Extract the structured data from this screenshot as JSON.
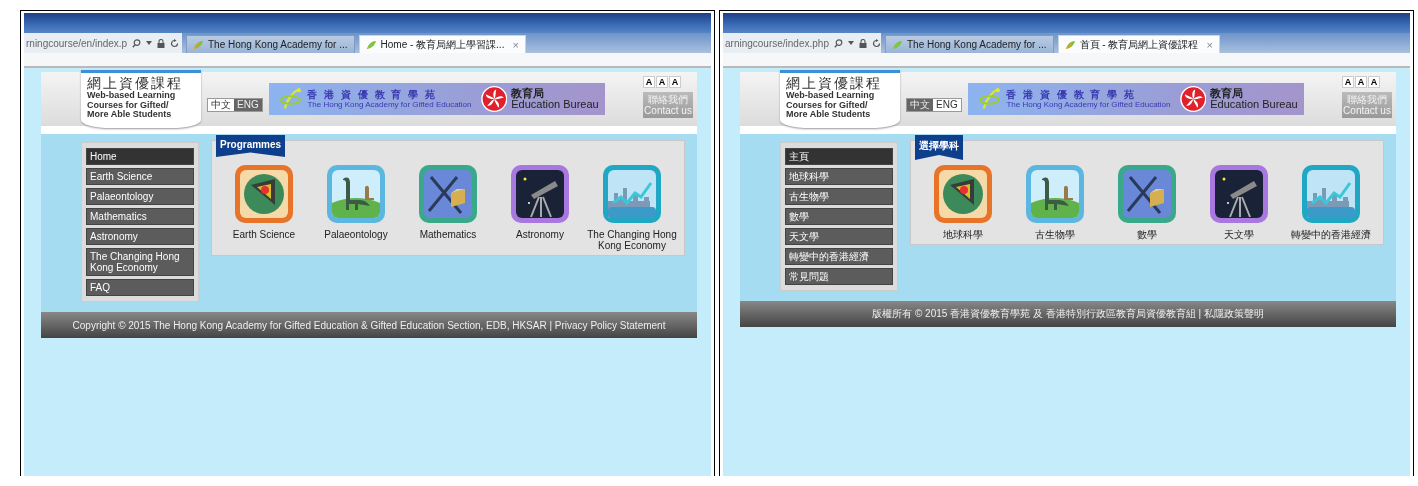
{
  "panels": [
    {
      "browser": {
        "address": "rningcourse/en/index.p",
        "tabs": [
          {
            "title": "The Hong Kong Academy for ...",
            "selected": false,
            "closable": false
          },
          {
            "title": "Home - 教育局網上學習課...",
            "selected": true,
            "closable": true,
            "close": "×"
          }
        ]
      },
      "site": {
        "logo_title": "網上資優課程",
        "logo_subtitle": "Web-based Learning Courses for Gifted/ More Able Students",
        "languages": [
          {
            "label": "中文",
            "selected": false
          },
          {
            "label": "ENG",
            "selected": true
          }
        ],
        "academy_cn": "香 港 資 優 教 育 學 苑",
        "academy_en": "The Hong Kong Academy for Gifted Education",
        "bureau_cn": "教育局",
        "bureau_en": "Education Bureau",
        "font_sizes": [
          "A",
          "A",
          "A"
        ],
        "contact_cn": "聯絡我們",
        "contact_en": "Contact us",
        "menu": [
          {
            "label": "Home",
            "selected": true
          },
          {
            "label": "Earth Science",
            "selected": false
          },
          {
            "label": "Palaeontology",
            "selected": false
          },
          {
            "label": "Mathematics",
            "selected": false
          },
          {
            "label": "Astronomy",
            "selected": false
          },
          {
            "label": "The Changing Hong Kong Economy",
            "selected": false
          },
          {
            "label": "FAQ",
            "selected": false
          }
        ],
        "programmes_heading": "Programmes",
        "programmes": [
          {
            "kind": "earth",
            "label": "Earth Science"
          },
          {
            "kind": "dinosaur",
            "label": "Palaeontology"
          },
          {
            "kind": "geometry",
            "label": "Mathematics"
          },
          {
            "kind": "telescope",
            "label": "Astronomy"
          },
          {
            "kind": "city",
            "label": "The Changing Hong Kong Economy"
          }
        ],
        "footer": "Copyright © 2015 The Hong Kong Academy for Gifted Education & Gifted Education Section, EDB, HKSAR | Privacy Policy Statement"
      }
    },
    {
      "browser": {
        "address": "arningcourse/index.php",
        "tabs": [
          {
            "title": "The Hong Kong Academy for ...",
            "selected": false,
            "closable": false
          },
          {
            "title": "首頁 - 教育局網上資優課程",
            "selected": true,
            "closable": true,
            "close": "×"
          }
        ]
      },
      "site": {
        "logo_title": "網上資優課程",
        "logo_subtitle": "Web-based Learning Courses for Gifted/ More Able Students",
        "languages": [
          {
            "label": "中文",
            "selected": true
          },
          {
            "label": "ENG",
            "selected": false
          }
        ],
        "academy_cn": "香 港 資 優 教 育 學 苑",
        "academy_en": "The Hong Kong Academy for Gifted Education",
        "bureau_cn": "教育局",
        "bureau_en": "Education Bureau",
        "font_sizes": [
          "A",
          "A",
          "A"
        ],
        "contact_cn": "聯絡我們",
        "contact_en": "Contact us",
        "menu": [
          {
            "label": "主頁",
            "selected": true
          },
          {
            "label": "地球科學",
            "selected": false
          },
          {
            "label": "古生物學",
            "selected": false
          },
          {
            "label": "數學",
            "selected": false
          },
          {
            "label": "天文學",
            "selected": false
          },
          {
            "label": "轉變中的香港經濟",
            "selected": false
          },
          {
            "label": "常見問題",
            "selected": false
          }
        ],
        "programmes_heading": "選擇學科",
        "programmes": [
          {
            "kind": "earth",
            "label": "地球科學"
          },
          {
            "kind": "dinosaur",
            "label": "古生物學"
          },
          {
            "kind": "geometry",
            "label": "數學"
          },
          {
            "kind": "telescope",
            "label": "天文學"
          },
          {
            "kind": "city",
            "label": "轉變中的香港經濟"
          }
        ],
        "footer": "版權所有 © 2015 香港資優教育學苑 及 香港特別行政區教育局資優教育組 | 私隱政策聲明"
      }
    }
  ]
}
